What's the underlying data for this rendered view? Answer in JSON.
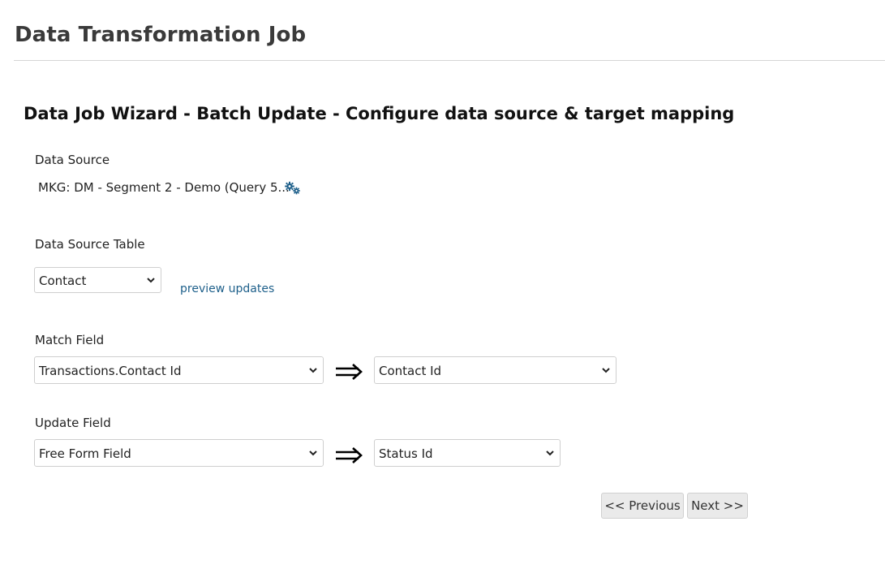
{
  "header": {
    "title": "Data Transformation Job"
  },
  "wizard": {
    "title": "Data Job Wizard - Batch Update - Configure data source & target mapping"
  },
  "data_source": {
    "label": "Data Source",
    "value": "MKG: DM - Segment 2 - Demo (Query 5...",
    "settings_icon": "gears-icon"
  },
  "data_source_table": {
    "label": "Data Source Table",
    "selected": "Contact",
    "preview_link": "preview updates"
  },
  "match_field": {
    "label": "Match Field",
    "source_selected": "Transactions.Contact Id",
    "target_selected": "Contact Id"
  },
  "update_field": {
    "label": "Update Field",
    "source_selected": "Free Form Field",
    "target_selected": "Status Id"
  },
  "buttons": {
    "previous": "<< Previous",
    "next": "Next >>"
  },
  "colors": {
    "link": "#1d5f8a",
    "icon": "#1d5f8a",
    "button_bg": "#eaeaea"
  }
}
